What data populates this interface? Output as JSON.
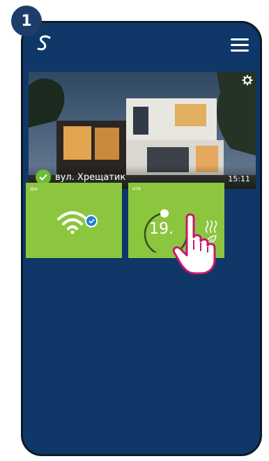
{
  "step_number": "1",
  "app": {
    "logo_icon": "salus-logo-icon",
    "menu_icon": "hamburger-menu-icon"
  },
  "location": {
    "name": "вул. Хрещатик",
    "time": "15:11",
    "status_icon": "check-circle-icon",
    "settings_icon": "gear-icon"
  },
  "tiles": [
    {
      "label": "Дім",
      "icon": "wifi-icon",
      "status_icon": "check-badge-icon"
    },
    {
      "label": "HTR",
      "temperature": "19.",
      "icons": [
        "heating-wave-icon",
        "leaf-icon"
      ]
    }
  ],
  "colors": {
    "background": "#0f3768",
    "tile_green": "#8cc63f",
    "badge_blue": "#1d3e6b",
    "accent_magenta": "#c8176c"
  }
}
